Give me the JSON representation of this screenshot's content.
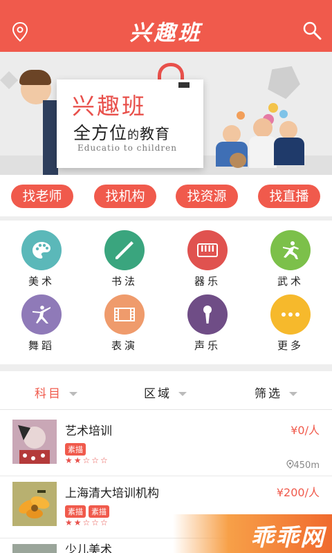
{
  "header": {
    "title": "兴趣班"
  },
  "banner": {
    "card_title": "兴趣班",
    "card_sub_main": "全方位",
    "card_sub_de": "的",
    "card_sub_edu": "教育",
    "card_en": "Educatio to children"
  },
  "quick": [
    "找老师",
    "找机构",
    "找资源",
    "找直播"
  ],
  "categories": [
    {
      "label": "美术",
      "color": "#5bb8b9",
      "icon": "palette-icon"
    },
    {
      "label": "书法",
      "color": "#3aa57e",
      "icon": "brush-icon"
    },
    {
      "label": "器乐",
      "color": "#e0524f",
      "icon": "piano-icon"
    },
    {
      "label": "武术",
      "color": "#7cc04a",
      "icon": "martial-icon"
    },
    {
      "label": "舞蹈",
      "color": "#8f7ab8",
      "icon": "dance-icon"
    },
    {
      "label": "表演",
      "color": "#ef9b6c",
      "icon": "film-icon"
    },
    {
      "label": "声乐",
      "color": "#6f4d86",
      "icon": "microphone-icon"
    },
    {
      "label": "更多",
      "color": "#f6b92c",
      "icon": "more-icon"
    }
  ],
  "filters": {
    "subject": "科目",
    "area": "区域",
    "filter": "筛选"
  },
  "list": [
    {
      "name": "艺术培训",
      "price": "¥0/人",
      "tags": [
        "素描"
      ],
      "stars": "★★☆☆☆",
      "distance": "450m"
    },
    {
      "name": "上海清大培训机构",
      "price": "¥200/人",
      "tags": [
        "素描",
        "素描"
      ],
      "stars": "★★☆☆☆",
      "distance": ""
    },
    {
      "name": "少儿美术",
      "price": "",
      "tags": [],
      "stars": "",
      "distance": ""
    }
  ],
  "watermark": "乖乖网",
  "colors": {
    "accent": "#f05a4c"
  }
}
